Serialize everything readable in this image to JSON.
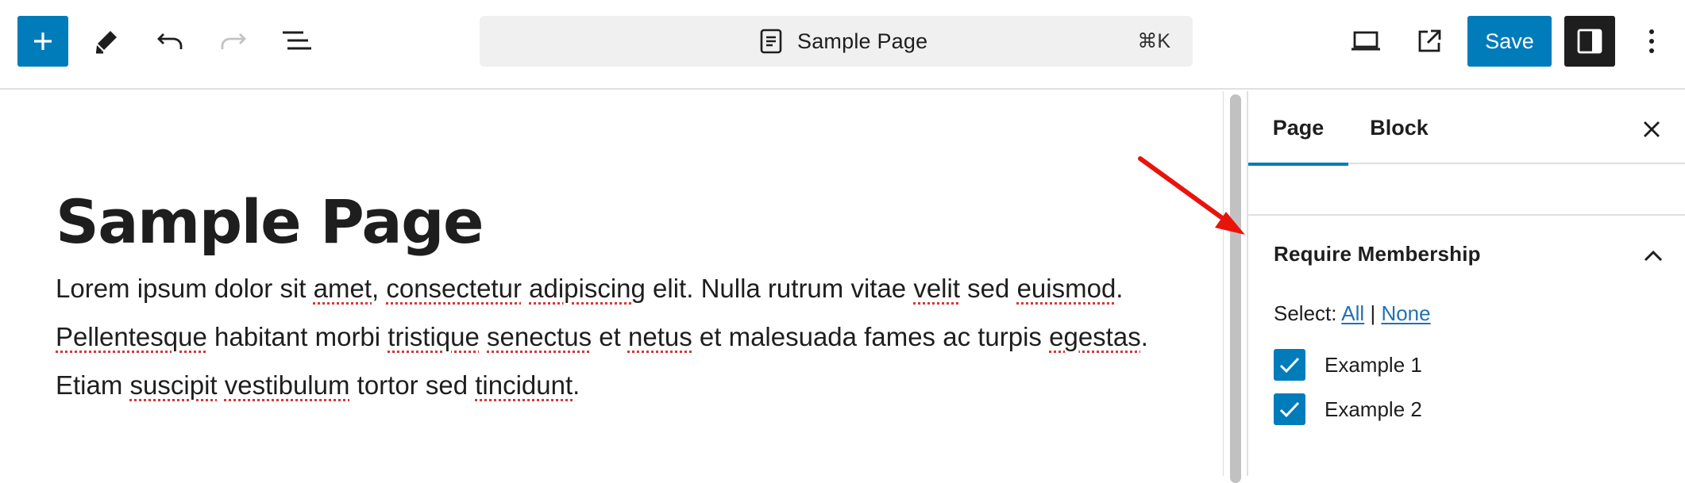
{
  "toolbar": {
    "add_icon": "plus-icon",
    "edit_icon": "pencil-icon",
    "undo_icon": "undo-icon",
    "redo_icon": "redo-icon",
    "list_view_icon": "list-view-icon",
    "document_title": "Sample Page",
    "document_icon": "page-icon",
    "shortcut": "⌘K",
    "preview_icon": "desktop-preview-icon",
    "view_page_icon": "external-link-icon",
    "save_label": "Save",
    "settings_icon": "sidebar-settings-icon",
    "options_icon": "more-vertical-icon",
    "accent_color": "#007cba"
  },
  "editor": {
    "title": "Sample Page",
    "paragraph": {
      "w1": "Lorem ipsum dolor sit ",
      "w2": "amet",
      "w3": ", ",
      "w4": "consectetur",
      "w5": " ",
      "w6": "adipiscing",
      "w7": " elit. Nulla rutrum vitae ",
      "w8": "velit",
      "w9": " sed ",
      "w10": "euismod",
      "w11": ". ",
      "w12": "Pellentesque",
      "w13": " habitant morbi ",
      "w14": "tristique",
      "w15": " ",
      "w16": "senectus",
      "w17": " et ",
      "w18": "netus",
      "w19": " et malesuada fames ac turpis ",
      "w20": "egestas",
      "w21": ". Etiam ",
      "w22": "suscipit",
      "w23": " ",
      "w24": "vestibulum",
      "w25": " tortor sed ",
      "w26": "tincidunt",
      "w27": "."
    }
  },
  "sidebar": {
    "tabs": [
      {
        "label": "Page",
        "active": true
      },
      {
        "label": "Block",
        "active": false
      }
    ],
    "close_icon": "close-icon",
    "panel": {
      "title": "Require Membership",
      "toggle_icon": "chevron-up-icon",
      "select_label": "Select:",
      "select_all": "All",
      "select_separator": "|",
      "select_none": "None",
      "options": [
        {
          "label": "Example 1",
          "checked": true
        },
        {
          "label": "Example 2",
          "checked": true
        }
      ]
    }
  },
  "annotation": {
    "arrow_color": "#e8140c"
  }
}
